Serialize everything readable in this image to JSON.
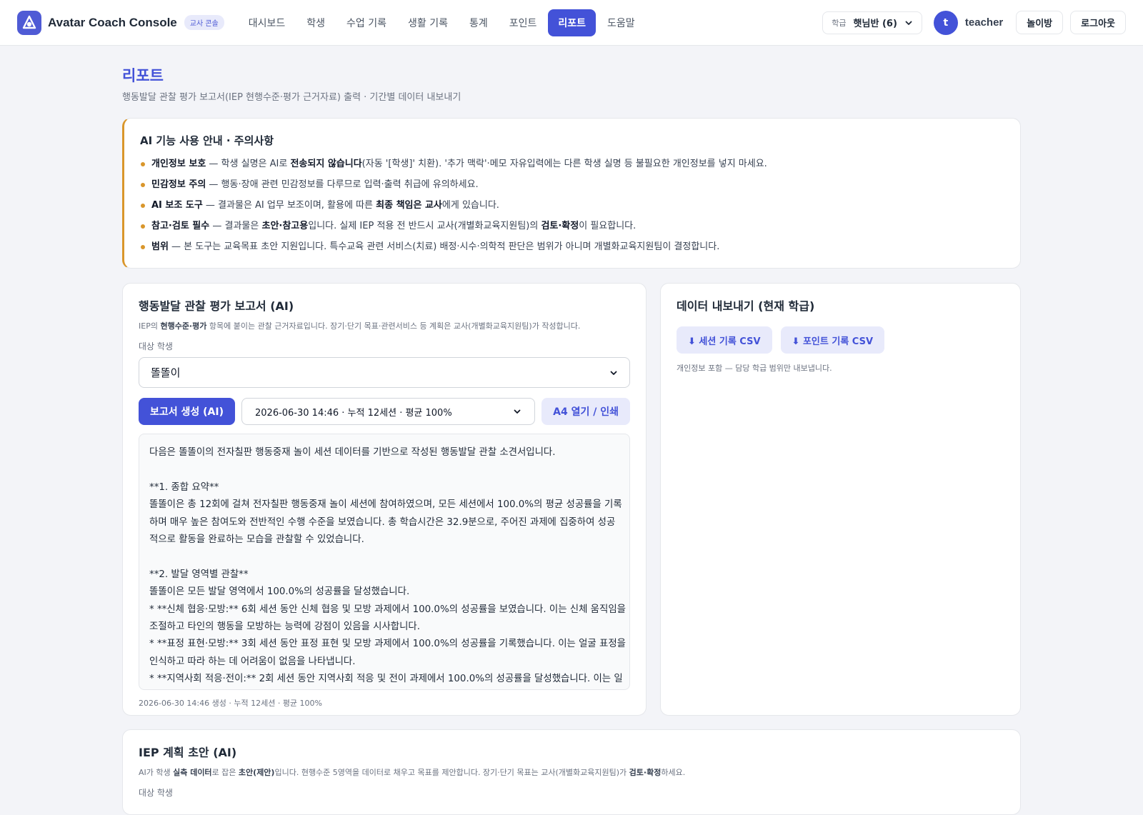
{
  "app": {
    "title": "Avatar Coach Console",
    "badge": "교사 콘솔"
  },
  "nav": {
    "items": [
      {
        "label": "대시보드"
      },
      {
        "label": "학생"
      },
      {
        "label": "수업 기록"
      },
      {
        "label": "생활 기록"
      },
      {
        "label": "통계"
      },
      {
        "label": "포인트"
      },
      {
        "label": "리포트",
        "active": true
      },
      {
        "label": "도움말"
      }
    ]
  },
  "topbar": {
    "class_label": "학급",
    "class_value": "햇님반 (6)",
    "avatar_initial": "t",
    "username": "teacher",
    "playroom_label": "놀이방",
    "logout_label": "로그아웃"
  },
  "page": {
    "title": "리포트",
    "subtitle": "행동발달 관찰 평가 보고서(IEP 현행수준·평가 근거자료) 출력 · 기간별 데이터 내보내기"
  },
  "notice": {
    "title": "AI 기능 사용 안내 · 주의사항",
    "items": [
      {
        "head": "개인정보 보호",
        "t1": " — 학생 실명은 AI로 ",
        "b1": "전송되지 않습니다",
        "t2": "(자동 '[학생]' 치환). '추가 맥락'·메모 자유입력에는 다른 학생 실명 등 불필요한 개인정보를 넣지 마세요.",
        "b2": "",
        "t3": ""
      },
      {
        "head": "민감정보 주의",
        "t1": " — 행동·장애 관련 민감정보를 다루므로 입력·출력 취급에 유의하세요.",
        "b1": "",
        "t2": "",
        "b2": "",
        "t3": ""
      },
      {
        "head": "AI 보조 도구",
        "t1": " — 결과물은 AI 업무 보조이며, 활용에 따른 ",
        "b1": "최종 책임은 교사",
        "t2": "에게 있습니다.",
        "b2": "",
        "t3": ""
      },
      {
        "head": "참고·검토 필수",
        "t1": " — 결과물은 ",
        "b1": "초안·참고용",
        "t2": "입니다. 실제 IEP 적용 전 반드시 교사(개별화교육지원팀)의 ",
        "b2": "검토·확정",
        "t3": "이 필요합니다."
      },
      {
        "head": "범위",
        "t1": " — 본 도구는 교육목표 초안 지원입니다. 특수교육 관련 서비스(치료) 배정·시수·의학적 판단은 범위가 아니며 개별화교육지원팀이 결정합니다.",
        "b1": "",
        "t2": "",
        "b2": "",
        "t3": ""
      }
    ]
  },
  "report": {
    "title": "행동발달 관찰 평가 보고서 (AI)",
    "desc_t1": "IEP의 ",
    "desc_b1": "현행수준·평가",
    "desc_t2": " 항목에 붙이는 관찰 근거자료입니다. 장기·단기 목표·관련서비스 등 계획은 교사(개별화교육지원팀)가 작성합니다.",
    "target_label": "대상 학생",
    "student_value": "똘똘이",
    "generate_label": "보고서 생성 (AI)",
    "run_value": "2026-06-30 14:46 · 누적 12세션 · 평균 100%",
    "print_label": "A4 열기 / 인쇄",
    "lines": [
      "다음은 똘똘이의 전자칠판 행동중재 놀이 세션 데이터를 기반으로 작성된 행동발달 관찰 소견서입니다.",
      "",
      "**1. 종합 요약**",
      "똘똘이은 총 12회에 걸쳐 전자칠판 행동중재 놀이 세션에 참여하였으며, 모든 세션에서 100.0%의 평균 성공률을 기록",
      "하며 매우 높은 참여도와 전반적인 수행 수준을 보였습니다. 총 학습시간은 32.9분으로, 주어진 과제에 집중하여 성공",
      "적으로 활동을 완료하는 모습을 관찰할 수 있었습니다.",
      "",
      "**2. 발달 영역별 관찰**",
      "똘똘이은 모든 발달 영역에서 100.0%의 성공률을 달성했습니다.",
      "* **신체 협응·모방:** 6회 세션 동안 신체 협응 및 모방 과제에서 100.0%의 성공률을 보였습니다. 이는 신체 움직임을",
      "조절하고 타인의 행동을 모방하는 능력에 강점이 있음을 시사합니다.",
      "* **표정 표현·모방:** 3회 세션 동안 표정 표현 및 모방 과제에서 100.0%의 성공률을 기록했습니다. 이는 얼굴 표정을",
      "인식하고 따라 하는 데 어려움이 없음을 나타냅니다.",
      "* **지역사회 적응·전이:** 2회 세션 동안 지역사회 적응 및 전이 과제에서 100.0%의 성공률을 달성했습니다. 이는 일"
    ],
    "footer": "2026-06-30 14:46 생성 · 누적 12세션 · 평균 100%"
  },
  "export": {
    "title": "데이터 내보내기 (현재 학급)",
    "session_csv": "⬇ 세션 기록 CSV",
    "point_csv": "⬇ 포인트 기록 CSV",
    "note": "개인정보 포함 — 담당 학급 범위만 내보냅니다."
  },
  "iep": {
    "title": "IEP 계획 초안 (AI)",
    "desc_t1": "AI가 학생 ",
    "desc_b1": "실측 데이터",
    "desc_t2": "로 잡은 ",
    "desc_b2": "초안(제안)",
    "desc_t3": "입니다. 현행수준 5영역을 데이터로 채우고 목표를 제안합니다. 장기·단기 목표는 교사(개별화교육지원팀)가 ",
    "desc_b3": "검토·확정",
    "desc_t4": "하세요.",
    "target_label": "대상 학생"
  }
}
